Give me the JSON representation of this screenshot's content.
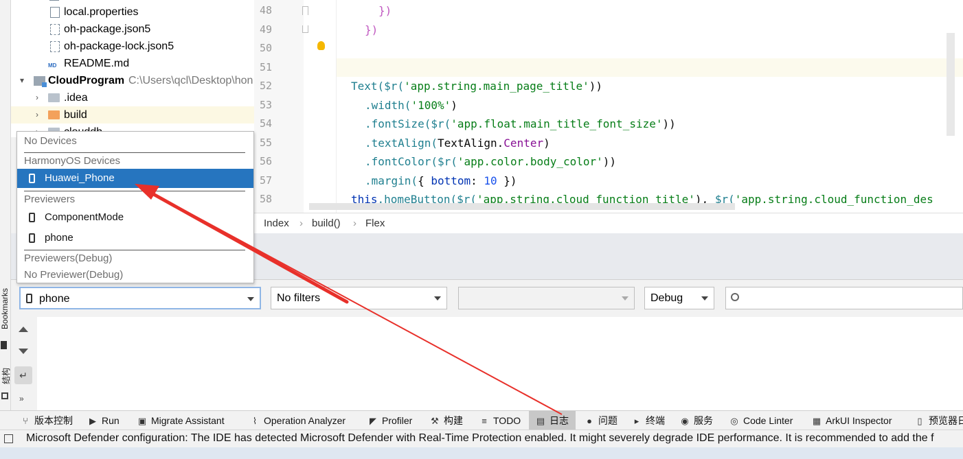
{
  "left_strip": {
    "bookmarks_label": "Bookmarks",
    "structure_label": "结构"
  },
  "project_tree": {
    "items": [
      {
        "label": "local.properties",
        "kind": "file"
      },
      {
        "label": "oh-package.json5",
        "kind": "json"
      },
      {
        "label": "oh-package-lock.json5",
        "kind": "json"
      },
      {
        "label": "README.md",
        "kind": "md"
      },
      {
        "label": "CloudProgram",
        "path": "C:\\Users\\qcl\\Desktop\\hon",
        "kind": "module"
      },
      {
        "label": ".idea",
        "kind": "folder"
      },
      {
        "label": "build",
        "kind": "folder-orange"
      },
      {
        "label": "clouddb",
        "kind": "folder"
      }
    ]
  },
  "editor": {
    "lines": [
      {
        "num": "48",
        "text": "})"
      },
      {
        "num": "49",
        "text": "})"
      },
      {
        "num": "50",
        "text": ""
      },
      {
        "num": "51",
        "text": ""
      },
      {
        "num": "52",
        "t1": "Text(",
        "t2": "$r(",
        "t3": "'app.string.main_page_title'",
        "t4": "))"
      },
      {
        "num": "53",
        "t1": ".width(",
        "t2": "'100%'",
        "t3": ")"
      },
      {
        "num": "54",
        "t1": ".fontSize(",
        "t2": "$r(",
        "t3": "'app.float.main_title_font_size'",
        "t4": "))"
      },
      {
        "num": "55",
        "t1": ".textAlign(",
        "t2": "TextAlign.",
        "t3": "Center",
        "t4": ")"
      },
      {
        "num": "56",
        "t1": ".fontColor(",
        "t2": "$r(",
        "t3": "'app.color.body_color'",
        "t4": "))"
      },
      {
        "num": "57",
        "t1": ".margin(",
        "t2": "{ ",
        "t3": "bottom",
        "t4": ": ",
        "t5": "10",
        "t6": " })"
      },
      {
        "num": "58",
        "t1": "this",
        "t2": ".homeButton(",
        "t3": "$r(",
        "t4": "'app.string.cloud_function_title'",
        "t5": "), ",
        "t6": "$r(",
        "t7": "'app.string.cloud_function_des"
      }
    ]
  },
  "breadcrumb": [
    "Index",
    "build()",
    "Flex"
  ],
  "log_toolbar": {
    "device_value": "phone",
    "filter_value": "No filters",
    "process_value": "",
    "level_value": "Debug",
    "search_value": ""
  },
  "device_popup": {
    "no_devices": "No Devices",
    "harmony_header": "HarmonyOS Devices",
    "harmony_items": [
      "Huawei_Phone"
    ],
    "previewers_header": "Previewers",
    "previewer_items": [
      "ComponentMode",
      "phone"
    ],
    "debug_header": "Previewers(Debug)",
    "no_debug": "No Previewer(Debug)"
  },
  "tool_tabs": [
    {
      "label": "版本控制",
      "icon": "branch-icon"
    },
    {
      "label": "Run",
      "icon": "run-icon"
    },
    {
      "label": "Migrate Assistant",
      "icon": "migrate-icon"
    },
    {
      "label": "Operation Analyzer",
      "icon": "analyzer-icon"
    },
    {
      "label": "Profiler",
      "icon": "profiler-icon"
    },
    {
      "label": "构建",
      "icon": "hammer-icon"
    },
    {
      "label": "TODO",
      "icon": "list-icon"
    },
    {
      "label": "日志",
      "icon": "log-icon"
    },
    {
      "label": "问题",
      "icon": "info-icon"
    },
    {
      "label": "终端",
      "icon": "terminal-icon"
    },
    {
      "label": "服务",
      "icon": "services-icon"
    },
    {
      "label": "Code Linter",
      "icon": "linter-icon"
    },
    {
      "label": "ArkUI Inspector",
      "icon": "inspector-icon"
    },
    {
      "label": "预览器日",
      "icon": "preview-log-icon"
    }
  ],
  "status_bar": {
    "message": "Microsoft Defender configuration: The IDE has detected Microsoft Defender with Real-Time Protection enabled. It might severely degrade IDE performance. It is recommended to add the f"
  },
  "colors": {
    "selection_blue": "#2675bf",
    "annotation_red": "#e8302a",
    "current_line": "#fcfaed"
  }
}
